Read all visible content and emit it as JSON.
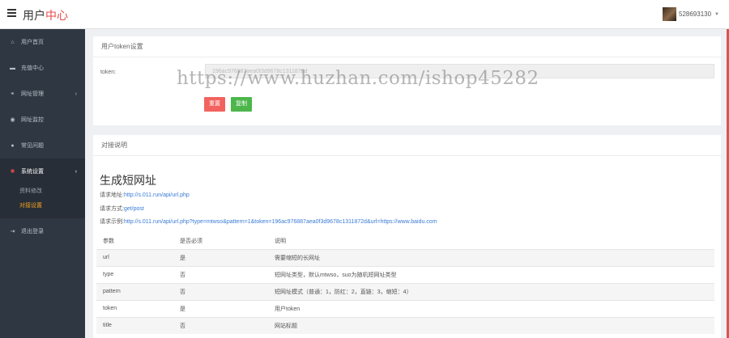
{
  "header": {
    "title_main": "用户",
    "title_accent": "中心",
    "username": "528693130"
  },
  "sidebar": {
    "items": [
      {
        "icon": "home-icon",
        "label": "用户首页"
      },
      {
        "icon": "cart-icon",
        "label": "充值中心"
      },
      {
        "icon": "link-icon",
        "label": "网址管理",
        "has_arrow": true
      },
      {
        "icon": "eye-icon",
        "label": "网址监控"
      },
      {
        "icon": "info-icon",
        "label": "常见问题"
      },
      {
        "icon": "gear-icon",
        "label": "系统设置",
        "has_arrow": true,
        "active": true
      },
      {
        "icon": "logout-icon",
        "label": "退出登录"
      }
    ],
    "submenu": [
      "资料修改",
      "对接设置"
    ],
    "submenu_current": "对接设置"
  },
  "token_card": {
    "header": "用户token设置",
    "label": "token:",
    "value": "196ac976887aea0f3d9678c1311872d",
    "reset_label": "重置",
    "copy_label": "复制"
  },
  "watermark": "https://www.huzhan.com/ishop45282",
  "doc_card": {
    "header": "对接说明",
    "title": "生成短网址",
    "lines": [
      {
        "prefix": "请求地址:",
        "link": "http://s.011.run/api/url.php"
      },
      {
        "prefix": "请求方式:",
        "link": "get/post"
      },
      {
        "prefix": "请求示例:",
        "link": "http://s.011.run/api/url.php?type=mtwso&pattern=1&token=196ac976887aea0f3d9678c1311872d&url=https://www.baidu.com"
      }
    ],
    "table": {
      "headers": [
        "参数",
        "是否必须",
        "说明"
      ],
      "rows": [
        [
          "url",
          "是",
          "需要缩短的长网址"
        ],
        [
          "type",
          "否",
          "短网址类型，默认mtwso，suo为随机短网址类型"
        ],
        [
          "pattern",
          "否",
          "短网址模式（普通：1，防红：2，直链：3，缩短：4）"
        ],
        [
          "token",
          "是",
          "用户token"
        ],
        [
          "title",
          "否",
          "网站标题"
        ]
      ]
    }
  },
  "colors": {
    "accent": "#e84a4a",
    "sidebar_bg": "#2f3742",
    "reset_button": "#f2635f",
    "copy_button": "#4cb64b",
    "submenu_current": "#f0a020"
  }
}
